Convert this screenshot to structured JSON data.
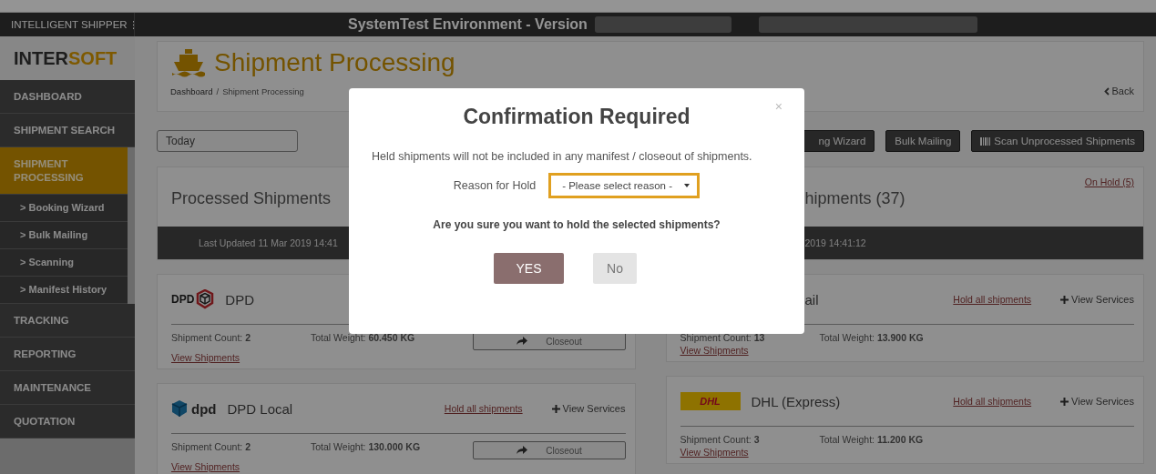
{
  "header": {
    "app_name": "INTELLIGENT SHIPPER",
    "title": "SystemTest Environment - Version"
  },
  "sidebar": {
    "logo": {
      "dark": "INTER",
      "accent": "SOFT"
    },
    "items": [
      {
        "label": "DASHBOARD",
        "kind": "main",
        "selected": false
      },
      {
        "label": "SHIPMENT SEARCH",
        "kind": "main",
        "selected": false
      },
      {
        "label": "SHIPMENT PROCESSING",
        "kind": "main",
        "selected": true
      },
      {
        "label": "> Booking Wizard",
        "kind": "sub",
        "selected": false
      },
      {
        "label": "> Bulk Mailing",
        "kind": "sub",
        "selected": false
      },
      {
        "label": "> Scanning",
        "kind": "sub",
        "selected": false
      },
      {
        "label": "> Manifest History",
        "kind": "sub",
        "selected": false
      },
      {
        "label": "TRACKING",
        "kind": "main",
        "selected": false
      },
      {
        "label": "REPORTING",
        "kind": "main",
        "selected": false
      },
      {
        "label": "MAINTENANCE",
        "kind": "main",
        "selected": false
      },
      {
        "label": "QUOTATION",
        "kind": "main",
        "selected": false
      }
    ]
  },
  "page": {
    "title": "Shipment Processing",
    "breadcrumb": {
      "link": "Dashboard",
      "separator": "/",
      "current": "Shipment Processing"
    },
    "back": "Back"
  },
  "toolbar": {
    "date_filter": "Today",
    "buttons": [
      {
        "label": "ng Wizard",
        "kind": "cut"
      },
      {
        "label": "Bulk Mailing",
        "kind": "plain"
      },
      {
        "label": "Scan Unprocessed Shipments",
        "kind": "scan"
      }
    ]
  },
  "columns": [
    {
      "title": "Processed Shipments",
      "updated": "Last Updated 11 Mar 2019 14:41",
      "cards": [
        {
          "name": "DPD",
          "logo": {
            "kind": "dpd",
            "text": "DPD"
          },
          "count_label": "Shipment Count:",
          "count": "2",
          "weight_label": "Total Weight:",
          "weight": "60.450 KG",
          "closeout": "Closeout",
          "view": "View Shipments"
        },
        {
          "name": "DPD Local",
          "logo": {
            "kind": "dpd-local",
            "text": "dpd"
          },
          "hold": "Hold all shipments",
          "services": "View Services",
          "count_label": "Shipment Count:",
          "count": "2",
          "weight_label": "Total Weight:",
          "weight": "130.000 KG",
          "closeout": "Closeout",
          "view": "View Shipments"
        }
      ]
    },
    {
      "title": "hipments (37)",
      "link": "On Hold (5)",
      "updated": "2019 14:41:12",
      "cards": [
        {
          "name": "ail",
          "hold": "Hold all shipments",
          "services": "View Services",
          "count_label": "Shipment Count:",
          "count": "13",
          "weight_label": "Total Weight:",
          "weight": "13.900 KG",
          "view": "View Shipments"
        },
        {
          "name": "DHL (Express)",
          "logo": {
            "kind": "dhl",
            "text": "DHL"
          },
          "hold": "Hold all shipments",
          "services": "View Services",
          "count_label": "Shipment Count:",
          "count": "3",
          "weight_label": "Total Weight:",
          "weight": "11.200 KG",
          "view": "View Shipments"
        }
      ]
    }
  ],
  "modal": {
    "close": "×",
    "title": "Confirmation Required",
    "message": "Held shipments will not be included in any manifest / closeout of shipments.",
    "field_label": "Reason for Hold",
    "select_value": "- Please select reason -",
    "question": "Are you sure you want to hold the selected shipments?",
    "buttons": [
      {
        "label": "YES",
        "kind": "primary"
      },
      {
        "label": "No",
        "kind": "secondary"
      }
    ]
  }
}
